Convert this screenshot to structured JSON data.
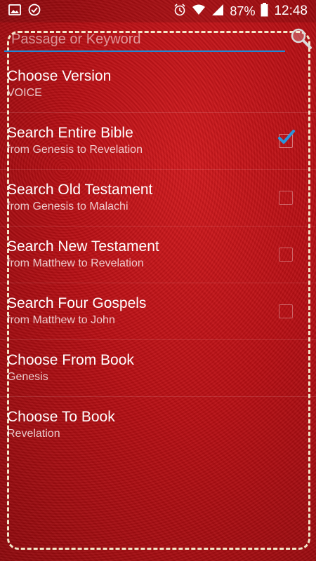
{
  "status_bar": {
    "left_icons": [
      "image-icon",
      "check-circle-icon"
    ],
    "battery_percent": "87%",
    "time": "12:48",
    "right_icons": [
      "alarm-icon",
      "wifi-icon",
      "signal-icon",
      "battery-icon"
    ]
  },
  "search": {
    "placeholder": "Passage or Keyword",
    "value": "",
    "button_icon": "search-icon"
  },
  "colors": {
    "background": "#b80f14",
    "accent": "#1f88d6",
    "stitch": "#f3e7c9"
  },
  "options": [
    {
      "title": "Choose Version",
      "subtitle": "VOICE",
      "checkbox": false,
      "checked": false
    },
    {
      "title": "Search Entire Bible",
      "subtitle": "from Genesis to Revelation",
      "checkbox": true,
      "checked": true
    },
    {
      "title": "Search Old Testament",
      "subtitle": "from Genesis to Malachi",
      "checkbox": true,
      "checked": false
    },
    {
      "title": "Search New Testament",
      "subtitle": "from Matthew to Revelation",
      "checkbox": true,
      "checked": false
    },
    {
      "title": "Search Four Gospels",
      "subtitle": "from Matthew to John",
      "checkbox": true,
      "checked": false
    },
    {
      "title": "Choose From Book",
      "subtitle": "Genesis",
      "checkbox": false,
      "checked": false
    },
    {
      "title": "Choose To Book",
      "subtitle": "Revelation",
      "checkbox": false,
      "checked": false
    }
  ]
}
